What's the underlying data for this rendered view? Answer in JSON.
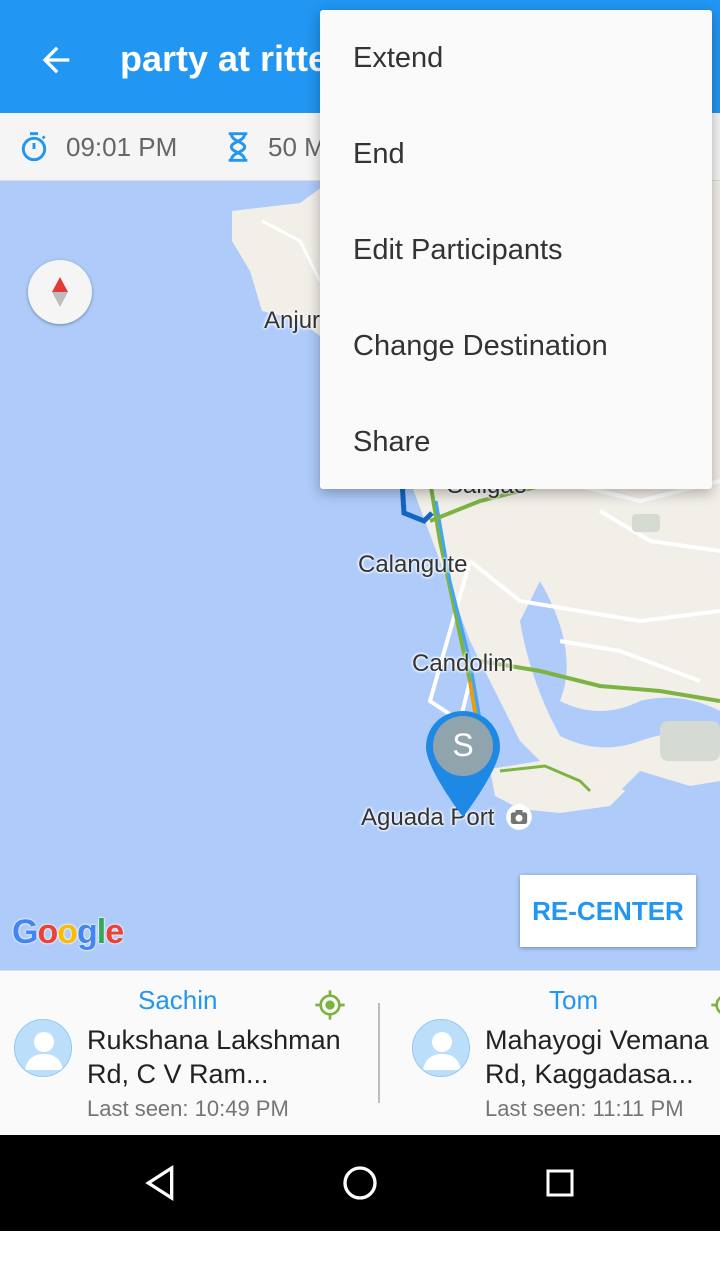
{
  "appbar": {
    "title": "party at ritte",
    "back_icon": "arrow-back-icon",
    "color": "#2196f3"
  },
  "infobar": {
    "time": "09:01 PM",
    "duration": "50 M"
  },
  "map": {
    "places": [
      "Anjur",
      "Saligao",
      "Calangute",
      "Candolim",
      "Aguada Port"
    ],
    "pin_letter": "S",
    "recenter_label": "RE-CENTER",
    "logo_letters": [
      "G",
      "o",
      "o",
      "g",
      "l",
      "e"
    ]
  },
  "menu": {
    "items": [
      "Extend",
      "End",
      "Edit Participants",
      "Change Destination",
      "Share"
    ]
  },
  "participants": [
    {
      "name": "Sachin",
      "address_line1": "Rukshana Lakshman",
      "address_line2": "Rd, C V Ram...",
      "last_seen": "Last seen: 10:49 PM"
    },
    {
      "name": "Tom",
      "address_line1": "Mahayogi Vemana",
      "address_line2": "Rd, Kaggadasa...",
      "last_seen": "Last seen: 11:11 PM"
    }
  ],
  "colors": {
    "accent": "#2196f3",
    "map_water": "#aecbfa",
    "map_land": "#f2efe9",
    "route": "#1565c0",
    "location_green": "#7cb342"
  }
}
